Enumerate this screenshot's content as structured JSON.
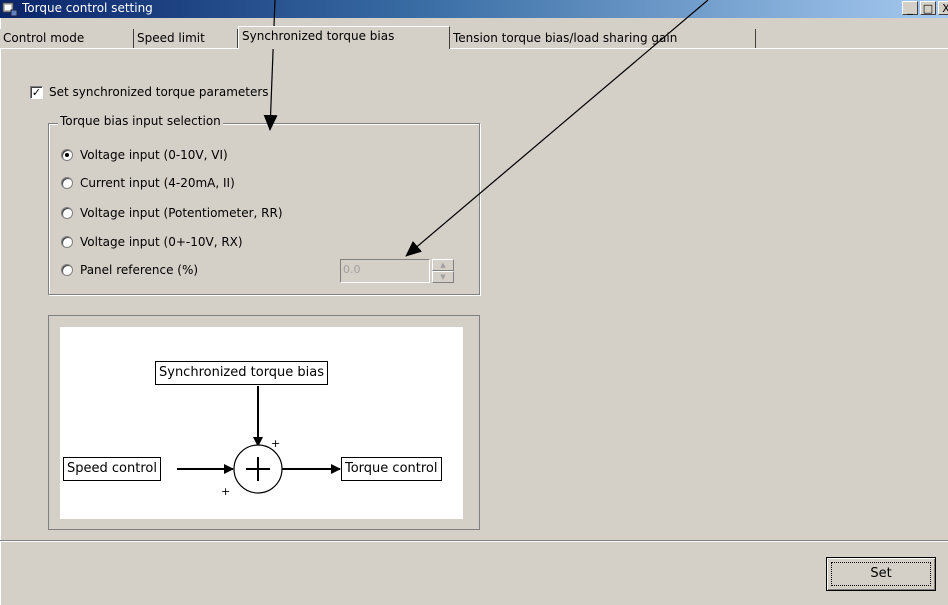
{
  "window": {
    "title": "Torque control setting"
  },
  "titlebar_buttons": {
    "minimize": "_",
    "maximize": "□",
    "close": "X"
  },
  "tabs": [
    {
      "label": "Control mode"
    },
    {
      "label": "Speed limit"
    },
    {
      "label": "Synchronized torque bias"
    },
    {
      "label": "Tension torque bias/load sharing gain"
    }
  ],
  "active_tab": "Synchronized torque bias",
  "checkbox": {
    "label": "Set synchronized torque parameters",
    "checked": true
  },
  "groupbox": {
    "title": "Torque bias input selection",
    "options": [
      {
        "label": "Voltage input (0-10V, VI)",
        "selected": true
      },
      {
        "label": "Current input (4-20mA, II)",
        "selected": false
      },
      {
        "label": "Voltage input (Potentiometer, RR)",
        "selected": false
      },
      {
        "label": "Voltage input (0+-10V, RX)",
        "selected": false
      },
      {
        "label": "Panel reference (%)",
        "selected": false
      }
    ],
    "panel_value": "0.0"
  },
  "diagram": {
    "top_label": "Synchronized torque bias",
    "left_label": "Speed control",
    "right_label": "Torque control",
    "sum_symbol": "+",
    "sign_top": "+",
    "sign_left": "+"
  },
  "set_button": {
    "label": "Set"
  },
  "colors": {
    "dialog": "#d4d0c8",
    "titlebar": "#0a246a"
  }
}
